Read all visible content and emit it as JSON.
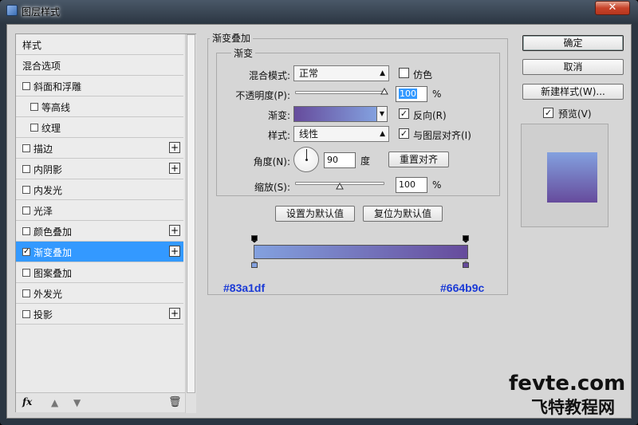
{
  "window": {
    "title": "图层样式",
    "close_label": "✕"
  },
  "left_list": {
    "items": [
      {
        "label": "样式",
        "checkbox": false,
        "plus": false,
        "indent": 0,
        "selected": false
      },
      {
        "label": "混合选项",
        "checkbox": false,
        "plus": false,
        "indent": 0,
        "selected": false
      },
      {
        "label": "斜面和浮雕",
        "checkbox": true,
        "checked": false,
        "plus": false,
        "indent": 0,
        "selected": false
      },
      {
        "label": "等高线",
        "checkbox": true,
        "checked": false,
        "plus": false,
        "indent": 1,
        "selected": false
      },
      {
        "label": "纹理",
        "checkbox": true,
        "checked": false,
        "plus": false,
        "indent": 1,
        "selected": false
      },
      {
        "label": "描边",
        "checkbox": true,
        "checked": false,
        "plus": true,
        "indent": 0,
        "selected": false
      },
      {
        "label": "内阴影",
        "checkbox": true,
        "checked": false,
        "plus": true,
        "indent": 0,
        "selected": false
      },
      {
        "label": "内发光",
        "checkbox": true,
        "checked": false,
        "plus": false,
        "indent": 0,
        "selected": false
      },
      {
        "label": "光泽",
        "checkbox": true,
        "checked": false,
        "plus": false,
        "indent": 0,
        "selected": false
      },
      {
        "label": "颜色叠加",
        "checkbox": true,
        "checked": false,
        "plus": true,
        "indent": 0,
        "selected": false
      },
      {
        "label": "渐变叠加",
        "checkbox": true,
        "checked": true,
        "plus": true,
        "indent": 0,
        "selected": true
      },
      {
        "label": "图案叠加",
        "checkbox": true,
        "checked": false,
        "plus": false,
        "indent": 0,
        "selected": false
      },
      {
        "label": "外发光",
        "checkbox": true,
        "checked": false,
        "plus": false,
        "indent": 0,
        "selected": false
      },
      {
        "label": "投影",
        "checkbox": true,
        "checked": false,
        "plus": true,
        "indent": 0,
        "selected": false
      }
    ],
    "fx_label": "fx"
  },
  "panel": {
    "group_title": "渐变叠加",
    "sub_title": "渐变",
    "blend_mode_label": "混合模式:",
    "blend_mode_value": "正常",
    "dither_label": "仿色",
    "opacity_label": "不透明度(P):",
    "opacity_value": "100",
    "opacity_unit": "%",
    "opacity_level": 1.0,
    "gradient_label": "渐变:",
    "reverse_label": "反向(R)",
    "style_label": "样式:",
    "style_value": "线性",
    "align_label": "与图层对齐(I)",
    "angle_label": "角度(N):",
    "angle_value": "90",
    "angle_unit": "度",
    "reset_align_label": "重置对齐",
    "scale_label": "缩放(S):",
    "scale_value": "100",
    "scale_unit": "%",
    "scale_level": 0.5,
    "make_default_label": "设置为默认值",
    "reset_default_label": "复位为默认值"
  },
  "gradient_editor": {
    "left_color": "#83a1df",
    "right_color": "#664b9c"
  },
  "right_buttons": {
    "ok": "确定",
    "cancel": "取消",
    "new_style": "新建样式(W)...",
    "preview_label": "预览(V)"
  },
  "watermark": {
    "line1": "fevte.com",
    "line2": "飞特教程网"
  },
  "colors": {
    "selected_bg": "#3399ff",
    "gradient_start": "#83a1df",
    "gradient_end": "#664b9c"
  }
}
